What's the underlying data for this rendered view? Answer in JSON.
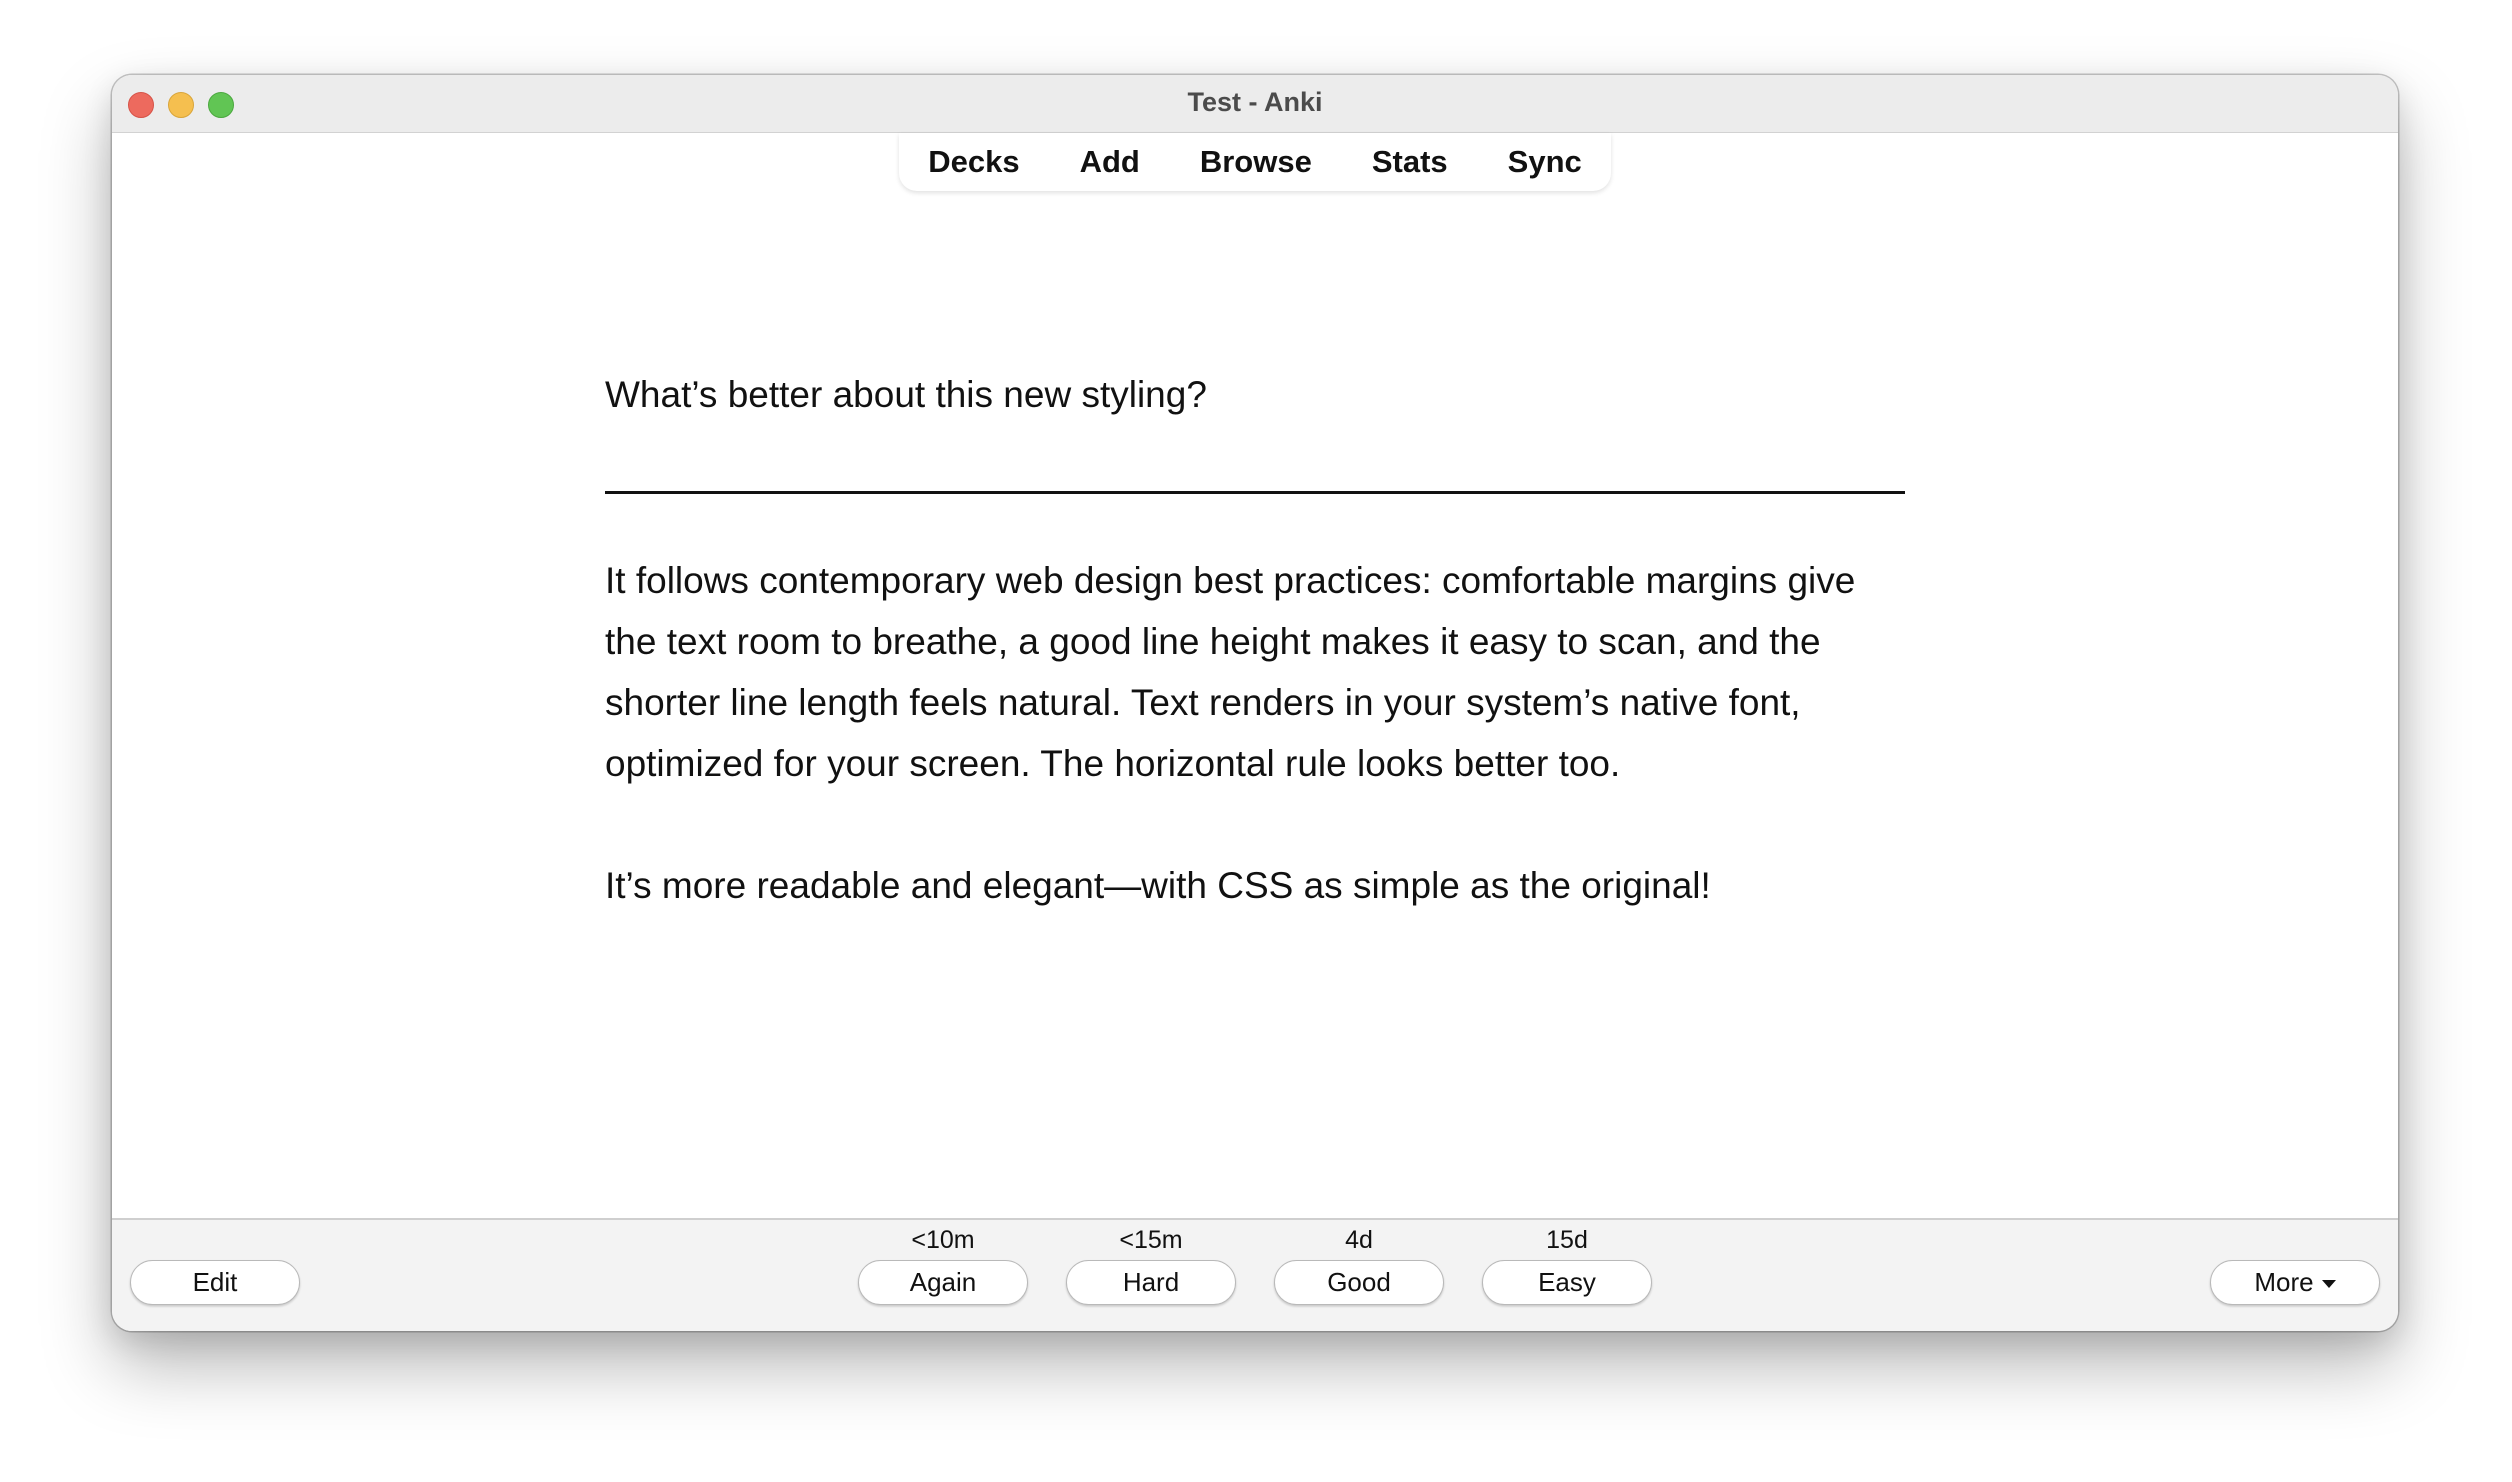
{
  "window": {
    "title": "Test - Anki"
  },
  "toolbar": {
    "items": [
      {
        "label": "Decks"
      },
      {
        "label": "Add"
      },
      {
        "label": "Browse"
      },
      {
        "label": "Stats"
      },
      {
        "label": "Sync"
      }
    ]
  },
  "card": {
    "question": "What’s better about this new styling?",
    "answer_paragraphs": [
      "It follows contemporary web design best practices: comfortable margins give the text room to breathe, a good line height makes it easy to scan, and the shorter line length feels natural. Text renders in your system’s native font, optimized for your screen. The horizontal rule looks better too.",
      "It’s more readable and elegant—with CSS as simple as the original!"
    ]
  },
  "bottombar": {
    "edit_label": "Edit",
    "more_label": "More",
    "answers": [
      {
        "label": "Again",
        "interval": "<10m"
      },
      {
        "label": "Hard",
        "interval": "<15m"
      },
      {
        "label": "Good",
        "interval": "4d"
      },
      {
        "label": "Easy",
        "interval": "15d"
      }
    ]
  },
  "colors": {
    "close": "#ed6a5e",
    "minimize": "#f5bf4f",
    "zoom": "#61c554"
  }
}
